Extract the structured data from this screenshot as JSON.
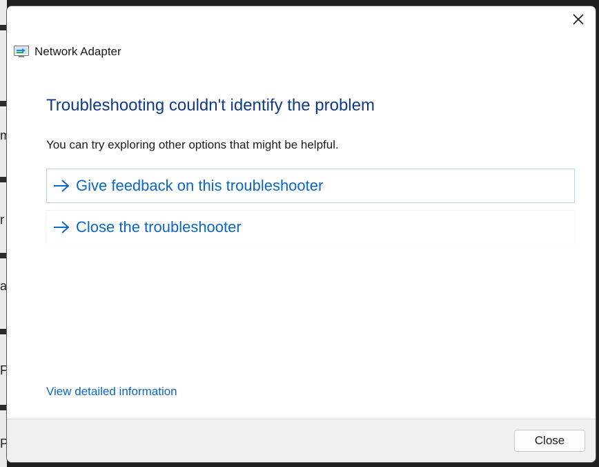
{
  "background_fragments": [
    "m",
    "r",
    "a",
    "F",
    "P"
  ],
  "window": {
    "close_icon": "close-icon",
    "app_icon": "network-adapter-icon",
    "title": "Network Adapter"
  },
  "main": {
    "heading": "Troubleshooting couldn't identify the problem",
    "subtext": "You can try exploring other options that might be helpful.",
    "options": [
      {
        "label": "Give feedback on this troubleshooter",
        "icon": "arrow-right-icon"
      },
      {
        "label": "Close the troubleshooter",
        "icon": "arrow-right-icon"
      }
    ],
    "details_link": "View detailed information"
  },
  "footer": {
    "close_label": "Close"
  },
  "colors": {
    "heading": "#0f3a8a",
    "link": "#0a66c8",
    "footer_bg": "#f0f0f0"
  }
}
